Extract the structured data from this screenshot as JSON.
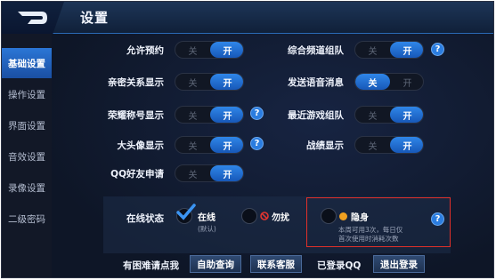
{
  "header": {
    "title": "设置"
  },
  "sidebar": {
    "items": [
      {
        "label": "基础设置"
      },
      {
        "label": "操作设置"
      },
      {
        "label": "界面设置"
      },
      {
        "label": "音效设置"
      },
      {
        "label": "录像设置"
      },
      {
        "label": "二级密码"
      }
    ]
  },
  "toggles": {
    "off_label": "关",
    "on_label": "开"
  },
  "settings": {
    "allow_reservation": {
      "label": "允许预约",
      "state": "on"
    },
    "intimate_display": {
      "label": "亲密关系显示",
      "state": "on"
    },
    "honor_title": {
      "label": "荣耀称号显示",
      "state": "on"
    },
    "big_avatar": {
      "label": "大头像显示",
      "state": "on"
    },
    "qq_friend_request": {
      "label": "QQ好友申请",
      "state": "on"
    },
    "channel_team": {
      "label": "综合频道组队",
      "state": "on"
    },
    "voice_message": {
      "label": "发送语音消息",
      "state": "off"
    },
    "recent_team": {
      "label": "最近游戏组队",
      "state": "on"
    },
    "record_display": {
      "label": "战绩显示",
      "state": "on"
    }
  },
  "online_status": {
    "label": "在线状态",
    "online": {
      "label": "在线",
      "sub": "(默认)"
    },
    "busy": {
      "label": "勿扰"
    },
    "invisible": {
      "label": "隐身",
      "note1": "本周可用3次，每日仅",
      "note2": "首次使用时消耗次数"
    }
  },
  "footer": {
    "help_text": "有困难请点我",
    "self_help": "自助查询",
    "contact": "联系客服",
    "logged_in": "已登录QQ",
    "logout": "退出登录"
  },
  "colors": {
    "accent": "#2f86e8",
    "highlight_border": "#e0302a"
  }
}
